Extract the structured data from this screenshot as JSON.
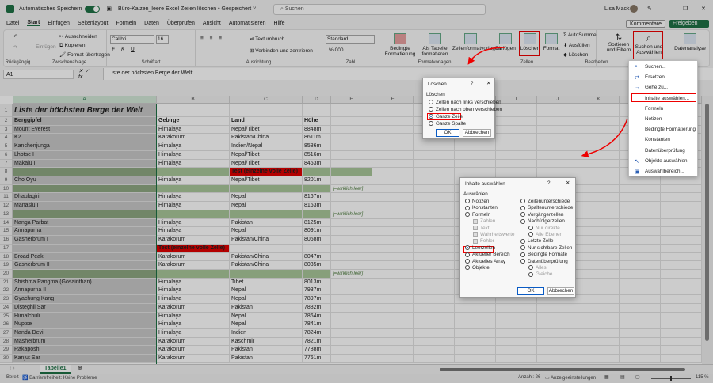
{
  "titlebar": {
    "autosave_label": "Automatisches Speichern",
    "autosave_on": true,
    "doc_title": "Büro-Kaizen_leere Excel Zeilen löschen • Gespeichert ˅",
    "search_placeholder": "Suchen",
    "user": "Lisa Mack"
  },
  "tabs": [
    "Datei",
    "Start",
    "Einfügen",
    "Seitenlayout",
    "Formeln",
    "Daten",
    "Überprüfen",
    "Ansicht",
    "Automatisieren",
    "Hilfe"
  ],
  "active_tab": "Start",
  "actions": {
    "comments": "Kommentare",
    "share": "Freigeben"
  },
  "ribbon": {
    "undo_group": "Rückgängig",
    "clipboard": {
      "label": "Zwischenablage",
      "paste": "Einfügen",
      "cut": "Ausschneiden",
      "copy": "Kopieren",
      "format_painter": "Format übertragen"
    },
    "font": {
      "label": "Schriftart",
      "name": "Calibri",
      "size": "16",
      "bold": "F",
      "italic": "K",
      "underline": "U"
    },
    "alignment": {
      "label": "Ausrichtung",
      "wrap": "Textumbruch",
      "merge": "Verbinden und zentrieren"
    },
    "number": {
      "label": "Zahl",
      "format": "Standard"
    },
    "styles": {
      "label": "Formatvorlagen",
      "conditional": "Bedingte Formatierung",
      "as_table": "Als Tabelle formatieren",
      "cell_styles": "Zellenformatvorlagen"
    },
    "cells": {
      "label": "Zellen",
      "insert": "Einfügen",
      "delete": "Löschen",
      "format": "Format"
    },
    "editing": {
      "label": "Bearbeiten",
      "autosum": "AutoSumme",
      "fill": "Ausfüllen",
      "clear": "Löschen",
      "sort": "Sortieren und Filtern",
      "find": "Suchen und Auswählen"
    },
    "analysis": "Datenanalyse"
  },
  "formula_bar": {
    "cell_ref": "A1",
    "content": "Liste der höchsten Berge der Welt"
  },
  "columns": [
    "A",
    "B",
    "C",
    "D",
    "E",
    "F",
    "G",
    "H",
    "I",
    "J",
    "K",
    "L",
    "M",
    "N"
  ],
  "sheet": {
    "title": "Liste der höchsten Berge der Welt",
    "headers": [
      "Berggipfel",
      "Gebirge",
      "Land",
      "Höhe"
    ],
    "rows": [
      [
        "Mount Everest",
        "Himalaya",
        "Nepal/Tibet",
        "8848m",
        ""
      ],
      [
        "K2",
        "Karakorum",
        "Pakistan/China",
        "8611m",
        ""
      ],
      [
        "Kanchenjunga",
        "Himalaya",
        "Indien/Nepal",
        "8586m",
        ""
      ],
      [
        "Lhotse I",
        "Himalaya",
        "Nepal/Tibet",
        "8516m",
        ""
      ],
      [
        "Makalu I",
        "Himalaya",
        "Nepal/Tibet",
        "8463m",
        ""
      ],
      [
        "",
        "",
        "Test (einzelne volle Zelle)",
        "",
        ""
      ],
      [
        "Cho Oyu",
        "Himalaya",
        "Nepal/Tibet",
        "8201m",
        ""
      ],
      [
        "",
        "",
        "",
        "",
        "[=wirklich leer]"
      ],
      [
        "Dhaulagiri",
        "Himalaya",
        "Nepal",
        "8167m",
        ""
      ],
      [
        "Manaslu I",
        "Himalaya",
        "Nepal",
        "8163m",
        ""
      ],
      [
        "",
        "",
        "",
        "",
        "[=wirklich leer]"
      ],
      [
        "Nanga Parbat",
        "Himalaya",
        "Pakistan",
        "8125m",
        ""
      ],
      [
        "Annapurna",
        "Himalaya",
        "Nepal",
        "8091m",
        ""
      ],
      [
        "Gasherbrum I",
        "Karakorum",
        "Pakistan/China",
        "8068m",
        ""
      ],
      [
        "",
        "Test (einzelne volle Zelle)",
        "",
        "",
        ""
      ],
      [
        "Broad Peak",
        "Karakorum",
        "Pakistan/China",
        "8047m",
        ""
      ],
      [
        "Gasherbrum II",
        "Karakorum",
        "Pakistan/China",
        "8035m",
        ""
      ],
      [
        "",
        "",
        "",
        "",
        "[=wirklich leer]"
      ],
      [
        "Shishma Pangma (Gosainthan)",
        "Himalaya",
        "Tibet",
        "8013m",
        ""
      ],
      [
        "Annapurna II",
        "Himalaya",
        "Nepal",
        "7937m",
        ""
      ],
      [
        "Gyachung Kang",
        "Himalaya",
        "Nepal",
        "7897m",
        ""
      ],
      [
        "Disteghil Sar",
        "Karakorum",
        "Pakistan",
        "7882m",
        ""
      ],
      [
        "Himalchuli",
        "Himalaya",
        "Nepal",
        "7864m",
        ""
      ],
      [
        "Nuptse",
        "Himalaya",
        "Nepal",
        "7841m",
        ""
      ],
      [
        "Nanda Devi",
        "Himalaya",
        "Indien",
        "7824m",
        ""
      ],
      [
        "Masherbrum",
        "Karakorum",
        "Kaschmir",
        "7821m",
        ""
      ],
      [
        "Rakaposhi",
        "Karakorum",
        "Pakistan",
        "7788m",
        ""
      ],
      [
        "Kanjut Sar",
        "Karakorum",
        "Pakistan",
        "7761m",
        ""
      ]
    ]
  },
  "colors": {
    "blank_row": "#a9c79a",
    "test_cell": "#e00000",
    "accent": "#1e7145"
  },
  "dialog_delete": {
    "title": "Löschen",
    "help": "?",
    "close": "✕",
    "section": "Löschen",
    "options": [
      "Zellen nach links verschieben",
      "Zellen nach oben verschieben",
      "Ganze Zeile",
      "Ganze Spalte"
    ],
    "selected": 2,
    "ok": "OK",
    "cancel": "Abbrechen"
  },
  "dialog_select": {
    "title": "Inhalte auswählen",
    "help": "?",
    "close": "✕",
    "section": "Auswählen",
    "left": [
      "Notizen",
      "Konstanten",
      "Formeln",
      "Zahlen",
      "Text",
      "Wahrheitswerte",
      "Fehler",
      "Leerzellen",
      "Aktueller Bereich",
      "Aktuelles Array",
      "Objekte"
    ],
    "right": [
      "Zeilenunterschiede",
      "Spaltenunterschiede",
      "Vorgängerzellen",
      "Nachfolgerzellen",
      "Nur direkte",
      "Alle Ebenen",
      "Letzte Zelle",
      "Nur sichtbare Zellen",
      "Bedingte Formate",
      "Datenüberprüfung",
      "Alles",
      "Gleiche"
    ],
    "selected": "Leerzellen",
    "ok": "OK",
    "cancel": "Abbrechen"
  },
  "find_menu": {
    "items": [
      "Suchen...",
      "Ersetzen...",
      "Gehe zu...",
      "Inhalte auswählen...",
      "Formeln",
      "Notizen",
      "Bedingte Formatierung",
      "Konstanten",
      "Datenüberprüfung",
      "Objekte auswählen",
      "Auswahlbereich..."
    ],
    "highlighted": "Inhalte auswählen..."
  },
  "sheet_tabs": {
    "active": "Tabelle1"
  },
  "status": {
    "ready": "Bereit",
    "accessibility": "Barrierefreiheit: Keine Probleme",
    "count": "Anzahl: 26",
    "display_settings": "Anzeigeeinstellungen",
    "zoom": "115 %",
    "zoom_level": 115
  }
}
